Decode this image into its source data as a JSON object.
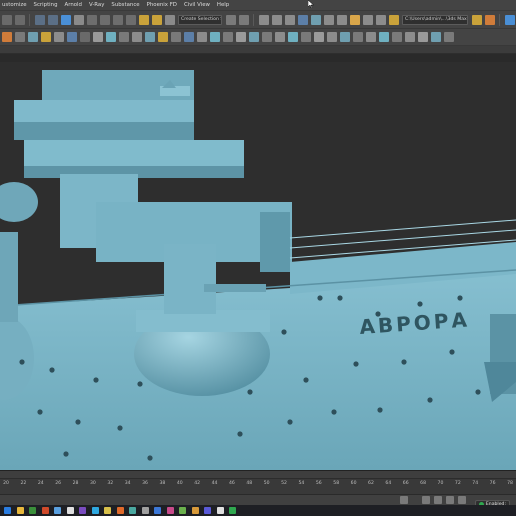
{
  "menubar": {
    "items": [
      "ustomize",
      "Scripting",
      "Arnold",
      "V-Ray",
      "Substance",
      "Phoenix FD",
      "Civil View",
      "Help"
    ]
  },
  "toolbar": {
    "selection_set_placeholder": "Create Selection Set",
    "path_value": "C:\\Users\\admin\\...\\3ds Max 2023"
  },
  "viewport": {
    "hull_lettering": "АВРОРА",
    "hull_color": "#7fb8c9",
    "background_color": "#2e2e2e"
  },
  "timeline": {
    "tick_labels": [
      "20",
      "22",
      "24",
      "26",
      "28",
      "30",
      "32",
      "34",
      "36",
      "38",
      "40",
      "42",
      "44",
      "46",
      "48",
      "50",
      "52",
      "54",
      "56",
      "58",
      "60",
      "62",
      "64",
      "66",
      "68",
      "70",
      "72",
      "74",
      "76",
      "78"
    ]
  },
  "status": {
    "enabled_label": "Enabled:"
  },
  "colors": {
    "ui_panel": "#444444",
    "accent_blue": "#4a8fd6",
    "enabled_green": "#2fa84f"
  }
}
